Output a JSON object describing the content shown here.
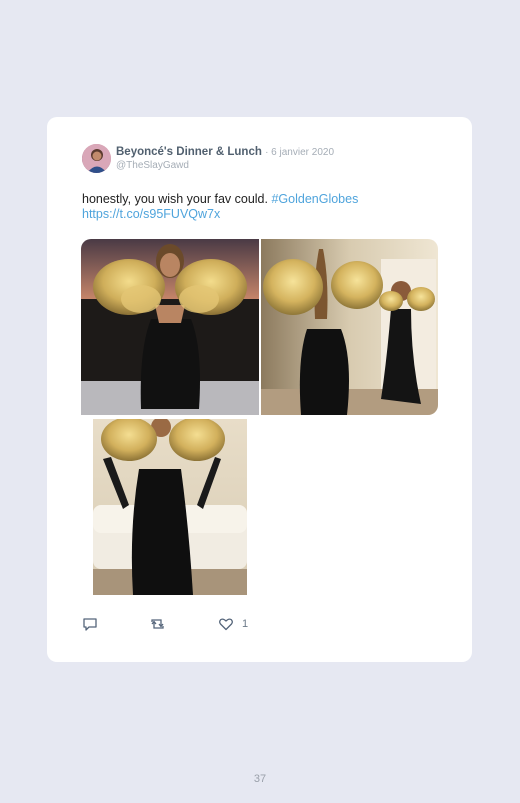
{
  "tweet": {
    "author_name": "Beyoncé's Dinner & Lunch",
    "date": "· 6 janvier 2020",
    "handle": "@TheSlayGawd",
    "text": "honestly, you wish your fav could.",
    "hashtag": "#GoldenGlobes",
    "url": "https://t.co/s95FUVQw7x",
    "photos": [
      {
        "icon": "photo-gold-gown-front"
      },
      {
        "icon": "photo-gold-gown-back"
      },
      {
        "icon": "photo-gold-gown-sofa"
      }
    ],
    "like_count": "1"
  },
  "page": {
    "number": "37"
  },
  "colors": {
    "background": "#e6e8f2",
    "card": "#ffffff",
    "link": "#4fa4dc",
    "author": "#51606f",
    "muted": "#a5adb6"
  }
}
